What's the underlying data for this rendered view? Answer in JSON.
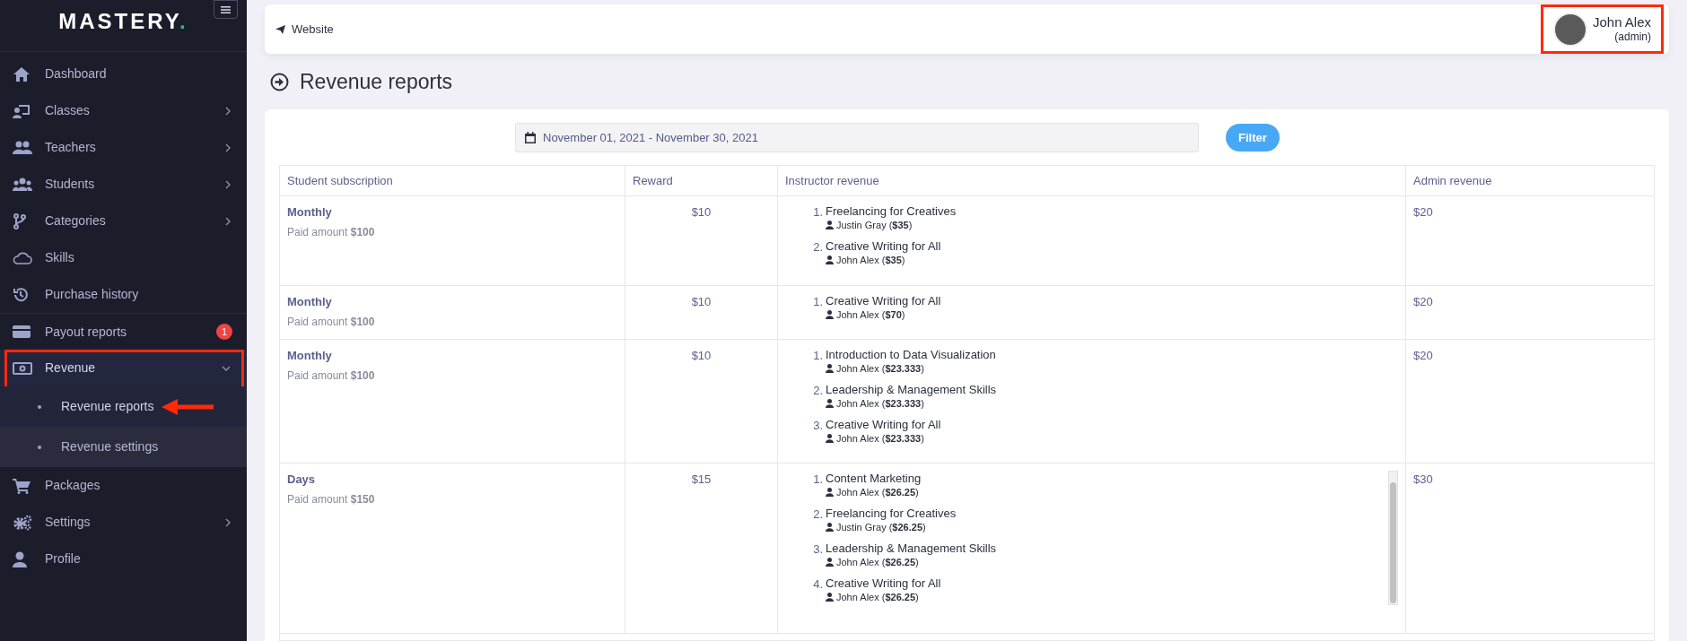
{
  "sidebar": {
    "logo": {
      "text": "MASTERY",
      "dot": "."
    },
    "items": [
      {
        "label": "Dashboard",
        "submenu": false,
        "selected": false
      },
      {
        "label": "Classes",
        "submenu": true,
        "expanded": false,
        "selected": false
      },
      {
        "label": "Teachers",
        "submenu": true,
        "expanded": false,
        "selected": false
      },
      {
        "label": "Students",
        "submenu": true,
        "expanded": false,
        "selected": false
      },
      {
        "label": "Categories",
        "submenu": true,
        "expanded": false,
        "selected": false
      },
      {
        "label": "Skills",
        "submenu": false,
        "selected": false
      },
      {
        "label": "Purchase history",
        "submenu": false,
        "selected": false
      },
      {
        "label": "Payout reports",
        "submenu": false,
        "selected": false,
        "badge": "1"
      },
      {
        "label": "Revenue",
        "submenu": true,
        "expanded": true,
        "selected": true,
        "children": [
          {
            "label": "Revenue reports",
            "selected": true
          },
          {
            "label": "Revenue settings",
            "selected": false
          }
        ]
      },
      {
        "label": "Packages",
        "submenu": false,
        "selected": false
      },
      {
        "label": "Settings",
        "submenu": true,
        "expanded": false,
        "selected": false
      },
      {
        "label": "Profile",
        "submenu": false,
        "selected": false
      }
    ]
  },
  "topbar": {
    "link": "Website",
    "user": {
      "name": "John Alex",
      "role": "(admin)"
    }
  },
  "page_title": "Revenue reports",
  "filter": {
    "date_range": "November 01, 2021 - November 30, 2021",
    "button": "Filter"
  },
  "table": {
    "columns": [
      "Student subscription",
      "Reward",
      "Instructor revenue",
      "Admin revenue"
    ],
    "rows": [
      {
        "plan": "Monthly",
        "paid": "Paid amount **$100**",
        "reward": "$10",
        "admin_revenue": "$20",
        "scrollable": false,
        "courses": [
          {
            "number": "1.",
            "title": "Freelancing for Creatives",
            "instructor": "Justin Gray (**$35**)"
          },
          {
            "number": "2.",
            "title": "Creative Writing for All",
            "instructor": "John Alex (**$35**)"
          }
        ]
      },
      {
        "plan": "Monthly",
        "paid": "Paid amount **$100**",
        "reward": "$10",
        "admin_revenue": "$20",
        "scrollable": false,
        "courses": [
          {
            "number": "1.",
            "title": "Creative Writing for All",
            "instructor": "John Alex (**$70**)"
          }
        ]
      },
      {
        "plan": "Monthly",
        "paid": "Paid amount **$100**",
        "reward": "$10",
        "admin_revenue": "$20",
        "scrollable": false,
        "courses": [
          {
            "number": "1.",
            "title": "Introduction to Data Visualization",
            "instructor": "John Alex (**$23.333**)"
          },
          {
            "number": "2.",
            "title": "Leadership & Management Skills",
            "instructor": "John Alex (**$23.333**)"
          },
          {
            "number": "3.",
            "title": "Creative Writing for All",
            "instructor": "John Alex (**$23.333**)"
          }
        ]
      },
      {
        "plan": "Days",
        "paid": "Paid amount **$150**",
        "reward": "$15",
        "admin_revenue": "$30",
        "scrollable": true,
        "courses": [
          {
            "number": "1.",
            "title": "Content Marketing",
            "instructor": "John Alex (**$26.25**)"
          },
          {
            "number": "2.",
            "title": "Freelancing for Creatives",
            "instructor": "Justin Gray (**$26.25**)"
          },
          {
            "number": "3.",
            "title": "Leadership & Management Skills",
            "instructor": "John Alex (**$26.25**)"
          },
          {
            "number": "4.",
            "title": "Creative Writing for All",
            "instructor": "John Alex (**$26.25**)"
          }
        ]
      }
    ]
  }
}
